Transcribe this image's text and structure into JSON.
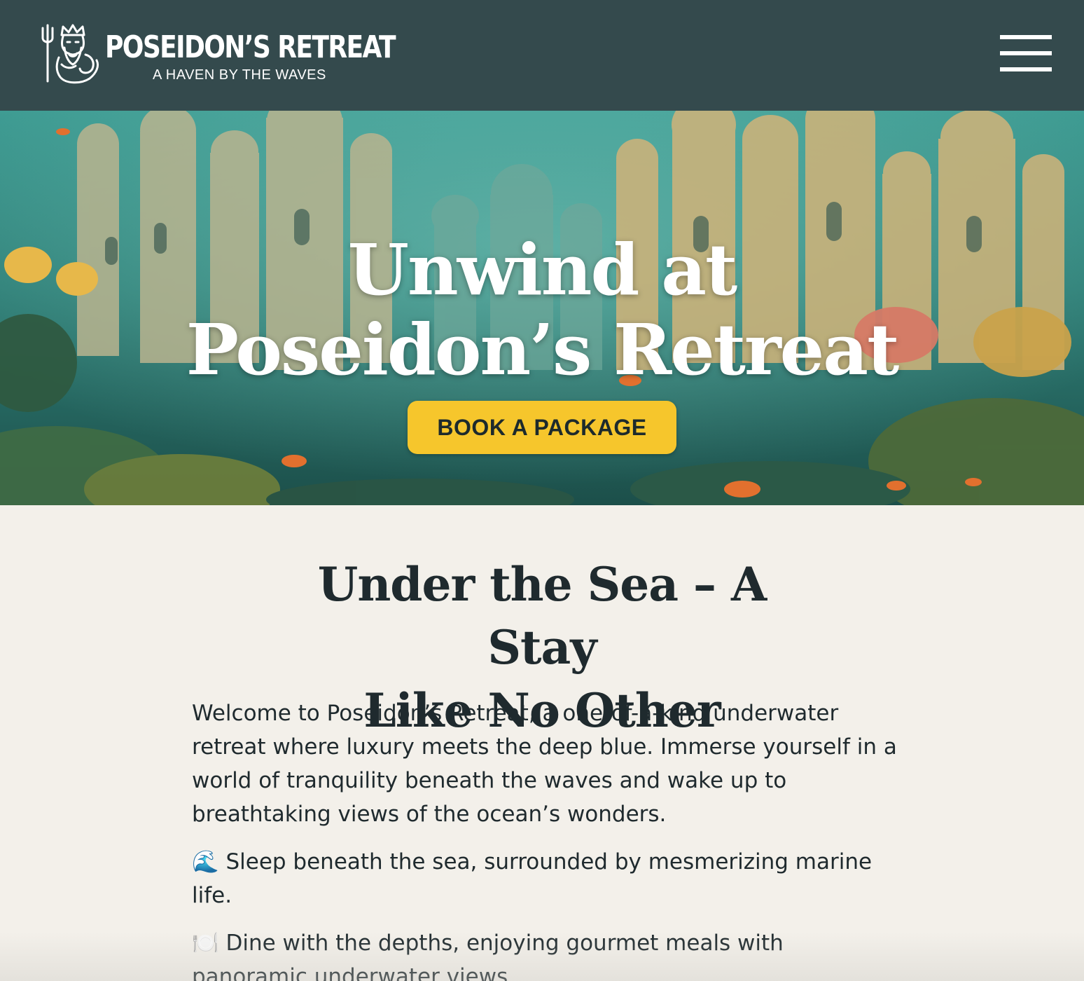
{
  "header": {
    "brand_name": "POSEIDON’S RETREAT",
    "tagline": "A HAVEN BY THE WAVES",
    "logo_icon": "poseidon-trident-logo-icon",
    "menu_icon": "hamburger-menu-icon",
    "background": "#344a4d"
  },
  "hero": {
    "title_line1": "Unwind at",
    "title_line2": "Poseidon’s Retreat",
    "cta_label": "BOOK A PACKAGE",
    "cta_color": "#f6c62c",
    "image": "underwater-city-coral-reef-image"
  },
  "intro": {
    "title_line1": "Under the Sea – A Stay",
    "title_line2": "Like No Other",
    "paragraph": "Welcome to Poseidon’s Retreat, a one-of-a-kind underwater retreat where luxury meets the deep blue. Immerse yourself in a world of tranquility beneath the waves and wake up to breathtaking views of the ocean’s wonders.",
    "features": [
      {
        "emoji": "🌊",
        "icon": "wave-icon",
        "text": "Sleep beneath the sea, surrounded by mesmerizing marine life."
      },
      {
        "emoji": "🍽️",
        "icon": "plate-icon",
        "text": "Dine with the depths, enjoying gourmet meals with panoramic underwater views."
      }
    ]
  },
  "colors": {
    "page_background": "#f3f0ea",
    "text": "#1f2a2e"
  }
}
